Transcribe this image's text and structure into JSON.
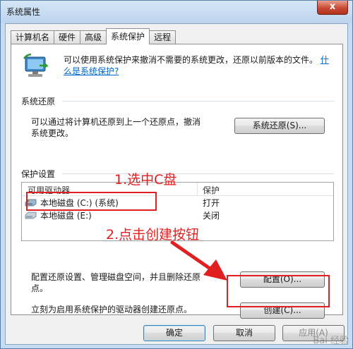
{
  "window": {
    "title": "系统属性",
    "close_label": "x"
  },
  "tabs": [
    {
      "label": "计算机名",
      "active": false
    },
    {
      "label": "硬件",
      "active": false
    },
    {
      "label": "高级",
      "active": false
    },
    {
      "label": "系统保护",
      "active": true
    },
    {
      "label": "远程",
      "active": false
    }
  ],
  "intro": {
    "text": "可以使用系统保护来撤消不需要的系统更改，还原以前版本的文件。",
    "link": "什么是系统保护?"
  },
  "restore": {
    "group_title": "系统还原",
    "description_line1": "可以通过将计算机还原到上一个还原点，撤消",
    "description_line2": "系统更改。",
    "button_label": "系统还原(S)..."
  },
  "protection": {
    "group_title": "保护设置",
    "columns": [
      "可用驱动器",
      "保护"
    ],
    "drives": [
      {
        "name": "本地磁盘 (C:) (系统)",
        "status": "打开",
        "icon": "system-drive-icon"
      },
      {
        "name": "本地磁盘 (E:)",
        "status": "关闭",
        "icon": "drive-icon"
      }
    ],
    "configure_text_line1": "配置还原设置、管理磁盘空间，并且删除还原",
    "configure_text_line2": "点。",
    "configure_button": "配置(O)...",
    "create_text": "立刻为启用系统保护的驱动器创建还原点。",
    "create_button": "创建(C)..."
  },
  "footer": {
    "ok": "确定",
    "cancel": "取消",
    "apply": "应用(A)"
  },
  "annotations": {
    "step1": "1.选中C盘",
    "step2": "2.点击创建按钮",
    "color": "#e02020"
  },
  "watermark": "Bai 经验"
}
